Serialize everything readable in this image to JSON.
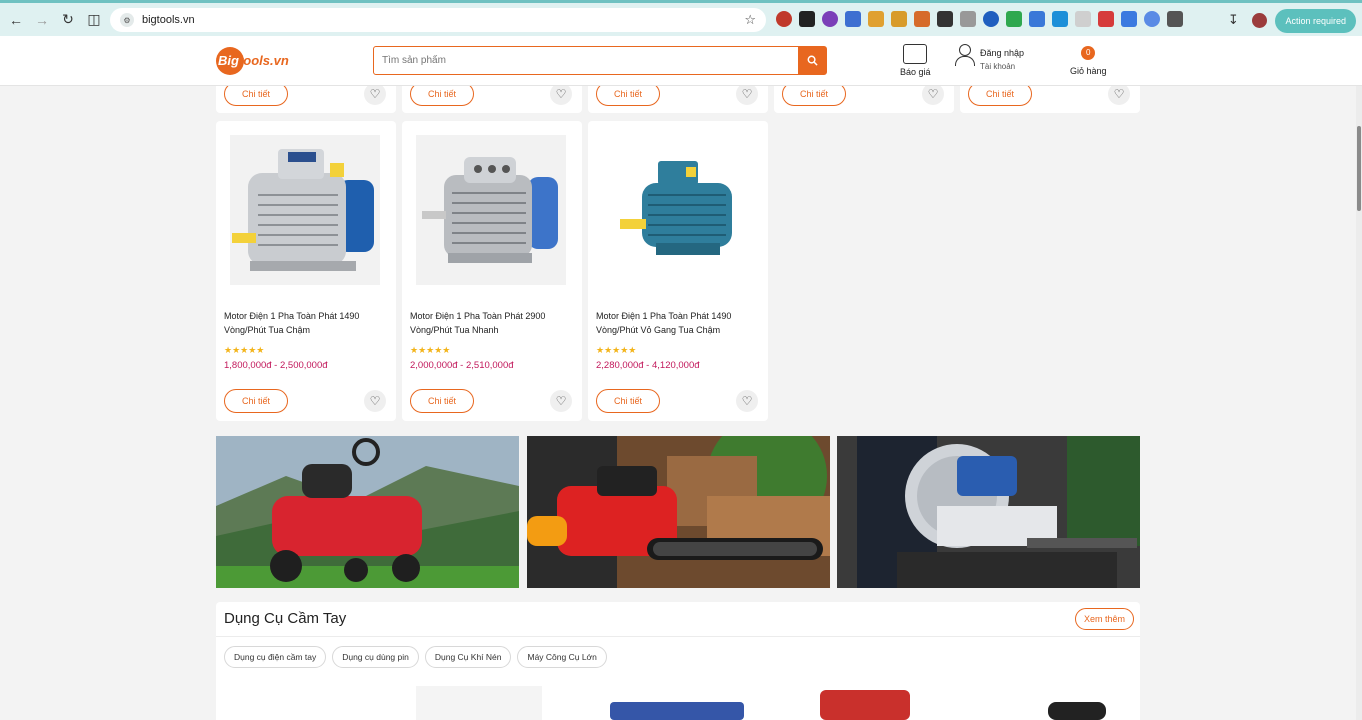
{
  "browser": {
    "url": "bigtools.vn",
    "action_required": "Action required"
  },
  "header": {
    "logo_big": "Big",
    "logo_rest": "tools.vn",
    "search_placeholder": "Tìm sản phẩm",
    "quote_label": "Báo giá",
    "login_label": "Đăng nhập",
    "account_label": "Tài khoản",
    "cart_count": "0",
    "cart_label": "Giỏ hàng"
  },
  "top_row": {
    "detail_label": "Chi tiết"
  },
  "products": [
    {
      "name": "Motor Điện 1 Pha Toàn Phát 1490 Vòng/Phút Tua Chậm",
      "stars": "★★★★★",
      "price": "1,800,000đ - 2,500,000đ",
      "detail_label": "Chi tiết"
    },
    {
      "name": "Motor Điện 1 Pha Toàn Phát 2900 Vòng/Phút Tua Nhanh",
      "stars": "★★★★★",
      "price": "2,000,000đ - 2,510,000đ",
      "detail_label": "Chi tiết"
    },
    {
      "name": "Motor Điện 1 Pha Toàn Phát 1490 Vòng/Phút Vỏ Gang Tua Chậm",
      "stars": "★★★★★",
      "price": "2,280,000đ - 4,120,000đ",
      "detail_label": "Chi tiết"
    }
  ],
  "section": {
    "title": "Dụng Cụ Cầm Tay",
    "more_label": "Xem thêm",
    "chips": [
      "Dụng cụ điện cầm tay",
      "Dụng cụ dùng pin",
      "Dụng Cụ Khí Nén",
      "Máy Công Cụ Lớn"
    ]
  },
  "icons": {
    "back": "arrow-left-icon",
    "forward": "arrow-right-icon",
    "reload": "reload-icon",
    "heart": "heart-icon",
    "search": "search-icon"
  },
  "colors": {
    "accent": "#e8671f",
    "price": "#c2185b",
    "star": "#f3b41a"
  }
}
